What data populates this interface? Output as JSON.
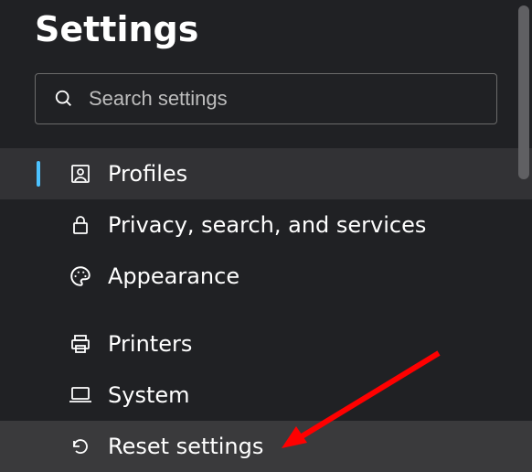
{
  "header": {
    "title": "Settings"
  },
  "search": {
    "placeholder": "Search settings"
  },
  "nav": {
    "items": [
      {
        "label": "Profiles",
        "icon": "profile-icon",
        "selected": true
      },
      {
        "label": "Privacy, search, and services",
        "icon": "lock-icon"
      },
      {
        "label": "Appearance",
        "icon": "palette-icon"
      },
      {
        "label": "Printers",
        "icon": "printer-icon"
      },
      {
        "label": "System",
        "icon": "laptop-icon"
      },
      {
        "label": "Reset settings",
        "icon": "reset-icon",
        "hover": true
      }
    ]
  }
}
